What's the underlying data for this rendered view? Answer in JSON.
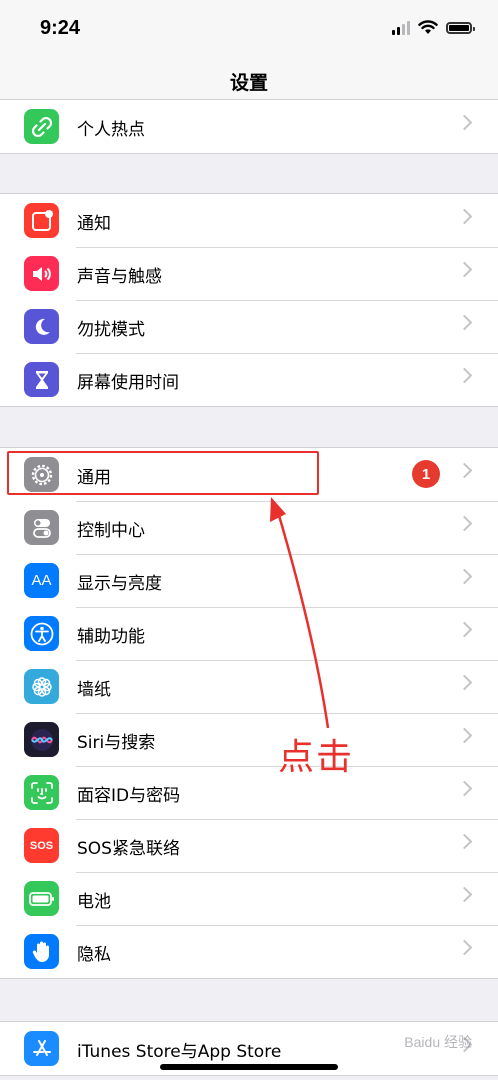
{
  "status_bar": {
    "time": "9:24"
  },
  "nav": {
    "title": "设置"
  },
  "groups": [
    {
      "rows": [
        {
          "label": "个人热点",
          "icon": "hotspot-icon",
          "color": "#34c759"
        }
      ]
    },
    {
      "rows": [
        {
          "label": "通知",
          "icon": "notifications-icon",
          "color": "#ff3b30"
        },
        {
          "label": "声音与触感",
          "icon": "sound-icon",
          "color": "#ff2d55"
        },
        {
          "label": "勿扰模式",
          "icon": "moon-icon",
          "color": "#5856d6"
        },
        {
          "label": "屏幕使用时间",
          "icon": "hourglass-icon",
          "color": "#5856d6"
        }
      ]
    },
    {
      "rows": [
        {
          "label": "通用",
          "icon": "gear-icon",
          "color": "#8e8e93",
          "badge": "1"
        },
        {
          "label": "控制中心",
          "icon": "toggles-icon",
          "color": "#8e8e93"
        },
        {
          "label": "显示与亮度",
          "icon": "text-size-icon",
          "color": "#007aff",
          "icon_text": "AA"
        },
        {
          "label": "辅助功能",
          "icon": "accessibility-icon",
          "color": "#007aff"
        },
        {
          "label": "墙纸",
          "icon": "flower-icon",
          "color": "#34aadc"
        },
        {
          "label": "Siri与搜索",
          "icon": "siri-icon",
          "color": "#1c1c2e"
        },
        {
          "label": "面容ID与密码",
          "icon": "face-id-icon",
          "color": "#34c759"
        },
        {
          "label": "SOS紧急联络",
          "icon": "sos-icon",
          "color": "#ff3b30",
          "icon_text": "SOS"
        },
        {
          "label": "电池",
          "icon": "battery-icon",
          "color": "#34c759"
        },
        {
          "label": "隐私",
          "icon": "hand-icon",
          "color": "#007aff"
        }
      ]
    },
    {
      "rows": [
        {
          "label": "iTunes Store与App Store",
          "icon": "app-store-icon",
          "color": "#1a8cff"
        }
      ]
    }
  ],
  "annotation": {
    "text": "点击",
    "color": "#e8302c"
  },
  "watermark": {
    "text": "Baidu 经验"
  }
}
